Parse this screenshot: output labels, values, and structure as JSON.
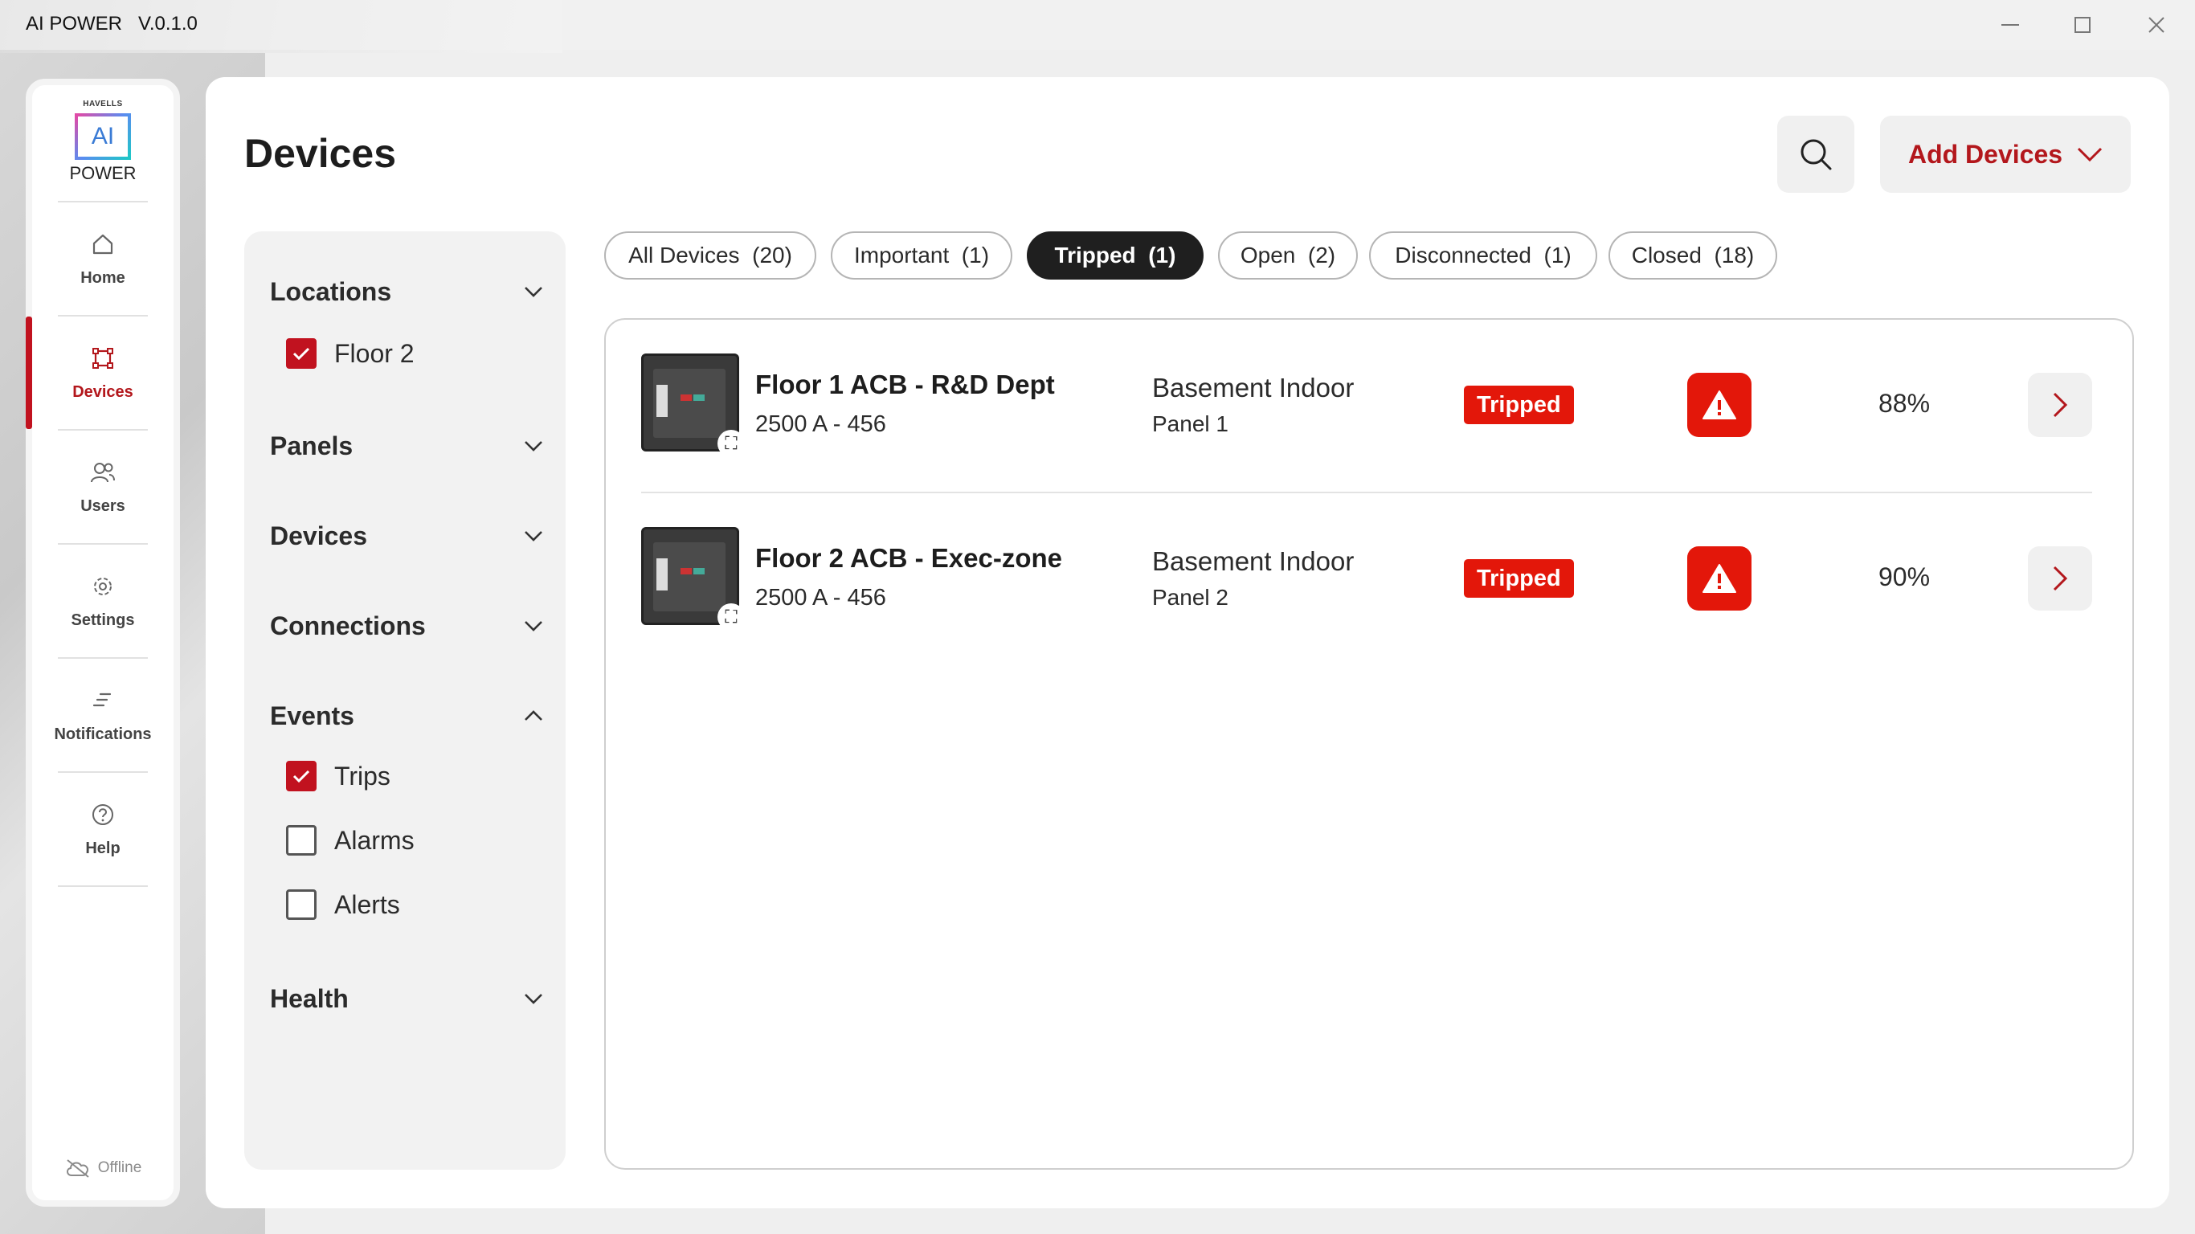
{
  "window": {
    "title": "AI POWER   V.0.1.0",
    "minimize": "—",
    "maximize": "☐",
    "close": "✕"
  },
  "logo": {
    "brand": "HAVELLS",
    "mark": "AI",
    "product": "POWER"
  },
  "nav": {
    "items": [
      {
        "label": "Home",
        "icon": "home-icon",
        "active": false
      },
      {
        "label": "Devices",
        "icon": "devices-icon",
        "active": true
      },
      {
        "label": "Users",
        "icon": "users-icon",
        "active": false
      },
      {
        "label": "Settings",
        "icon": "gear-icon",
        "active": false
      },
      {
        "label": "Notifications",
        "icon": "notifications-icon",
        "active": false
      },
      {
        "label": "Help",
        "icon": "help-icon",
        "active": false
      }
    ],
    "status": "Offline"
  },
  "header": {
    "title": "Devices",
    "add_label": "Add Devices"
  },
  "filters": {
    "locations": {
      "label": "Locations",
      "options": [
        {
          "label": "Floor 2",
          "checked": true
        }
      ]
    },
    "panels": {
      "label": "Panels"
    },
    "devices": {
      "label": "Devices"
    },
    "connections": {
      "label": "Connections"
    },
    "events": {
      "label": "Events",
      "options": [
        {
          "label": "Trips",
          "checked": true
        },
        {
          "label": "Alarms",
          "checked": false
        },
        {
          "label": "Alerts",
          "checked": false
        }
      ]
    },
    "health": {
      "label": "Health"
    }
  },
  "tabs": [
    {
      "label": "All Devices  (20)",
      "active": false
    },
    {
      "label": "Important  (1)",
      "active": false
    },
    {
      "label": "Tripped  (1)",
      "active": true
    },
    {
      "label": "Open  (2)",
      "active": false
    },
    {
      "label": "Disconnected  (1)",
      "active": false
    },
    {
      "label": "Closed  (18)",
      "active": false
    }
  ],
  "devices": [
    {
      "name": "Floor 1 ACB - R&D Dept",
      "spec": "2500 A - 456",
      "location": "Basement Indoor",
      "panel": "Panel 1",
      "status": "Tripped",
      "health": "88%"
    },
    {
      "name": "Floor 2 ACB - Exec-zone",
      "spec": "2500 A - 456",
      "location": "Basement Indoor",
      "panel": "Panel 2",
      "status": "Tripped",
      "health": "90%"
    }
  ],
  "colors": {
    "accent": "#c1121f",
    "status_red": "#e3170a",
    "dark": "#1f1f1f"
  }
}
